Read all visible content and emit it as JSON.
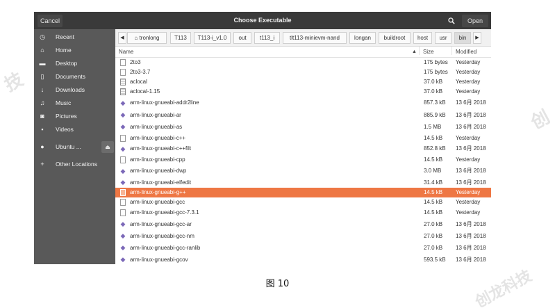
{
  "titlebar": {
    "cancel": "Cancel",
    "title": "Choose Executable",
    "open": "Open",
    "search_icon": "search-icon"
  },
  "sidebar": {
    "items": [
      {
        "label": "Recent",
        "icon": "◷"
      },
      {
        "label": "Home",
        "icon": "⌂"
      },
      {
        "label": "Desktop",
        "icon": "▬"
      },
      {
        "label": "Documents",
        "icon": "▯"
      },
      {
        "label": "Downloads",
        "icon": "↓"
      },
      {
        "label": "Music",
        "icon": "♫"
      },
      {
        "label": "Pictures",
        "icon": "◙"
      },
      {
        "label": "Videos",
        "icon": "▪"
      },
      {
        "label": "Ubuntu ...",
        "icon": "●"
      },
      {
        "label": "Other Locations",
        "icon": "+"
      }
    ]
  },
  "pathbar": {
    "crumbs": [
      "tronlong",
      "T113",
      "T113-i_v1.0",
      "out",
      "t113_i",
      "tlt113-minievm-nand",
      "longan",
      "buildroot",
      "host",
      "usr",
      "bin"
    ]
  },
  "columns": {
    "name": "Name",
    "size": "Size",
    "modified": "Modified"
  },
  "files": [
    {
      "name": "2to3",
      "size": "175 bytes",
      "modified": "Yesterday",
      "type": "doc"
    },
    {
      "name": "2to3-3.7",
      "size": "175 bytes",
      "modified": "Yesterday",
      "type": "doc"
    },
    {
      "name": "aclocal",
      "size": "37.0 kB",
      "modified": "Yesterday",
      "type": "script"
    },
    {
      "name": "aclocal-1.15",
      "size": "37.0 kB",
      "modified": "Yesterday",
      "type": "script"
    },
    {
      "name": "arm-linux-gnueabi-addr2line",
      "size": "857.3 kB",
      "modified": "13 6月 2018",
      "type": "exec"
    },
    {
      "name": "arm-linux-gnueabi-ar",
      "size": "885.9 kB",
      "modified": "13 6月 2018",
      "type": "exec"
    },
    {
      "name": "arm-linux-gnueabi-as",
      "size": "1.5 MB",
      "modified": "13 6月 2018",
      "type": "exec"
    },
    {
      "name": "arm-linux-gnueabi-c++",
      "size": "14.5 kB",
      "modified": "Yesterday",
      "type": "doc"
    },
    {
      "name": "arm-linux-gnueabi-c++filt",
      "size": "852.8 kB",
      "modified": "13 6月 2018",
      "type": "exec"
    },
    {
      "name": "arm-linux-gnueabi-cpp",
      "size": "14.5 kB",
      "modified": "Yesterday",
      "type": "doc"
    },
    {
      "name": "arm-linux-gnueabi-dwp",
      "size": "3.0 MB",
      "modified": "13 6月 2018",
      "type": "exec"
    },
    {
      "name": "arm-linux-gnueabi-elfedit",
      "size": "31.4 kB",
      "modified": "13 6月 2018",
      "type": "exec"
    },
    {
      "name": "arm-linux-gnueabi-g++",
      "size": "14.5 kB",
      "modified": "Yesterday",
      "type": "doc"
    },
    {
      "name": "arm-linux-gnueabi-gcc",
      "size": "14.5 kB",
      "modified": "Yesterday",
      "type": "doc"
    },
    {
      "name": "arm-linux-gnueabi-gcc-7.3.1",
      "size": "14.5 kB",
      "modified": "Yesterday",
      "type": "doc"
    },
    {
      "name": "arm-linux-gnueabi-gcc-ar",
      "size": "27.0 kB",
      "modified": "13 6月 2018",
      "type": "exec"
    },
    {
      "name": "arm-linux-gnueabi-gcc-nm",
      "size": "27.0 kB",
      "modified": "13 6月 2018",
      "type": "exec"
    },
    {
      "name": "arm-linux-gnueabi-gcc-ranlib",
      "size": "27.0 kB",
      "modified": "13 6月 2018",
      "type": "exec"
    },
    {
      "name": "arm-linux-gnueabi-gcov",
      "size": "593.5 kB",
      "modified": "13 6月 2018",
      "type": "exec"
    }
  ],
  "selected_file": "arm-linux-gnueabi-g++",
  "caption": "图 10",
  "watermarks": [
    "技",
    "创",
    "创龙科技"
  ],
  "colors": {
    "selection": "#ee7744",
    "titlebar": "#3a3a3a",
    "sidebar": "#595959"
  }
}
